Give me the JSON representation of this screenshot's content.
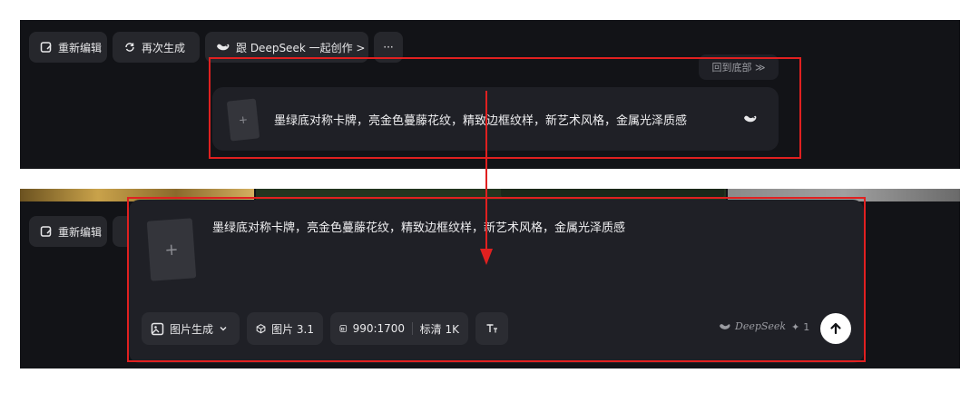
{
  "toolbar": {
    "reedit_label": "重新编辑",
    "regenerate_label": "再次生成",
    "create_with_label": "跟 DeepSeek 一起创作 >",
    "more_label": "···"
  },
  "back_to_bottom_label": "回到底部 ≫",
  "prompt": {
    "text": "墨绿底对称卡牌，亮金色蔓藤花纹，精致边框纹样，新艺术风格，金属光泽质感"
  },
  "bottom_toolbar": {
    "mode_label": "图片生成",
    "model_label": "图片 3.1",
    "ratio_label": "990:1700",
    "quality_label": "标清 1K",
    "deepseek_label": "DeepSeek",
    "credits_label": "1"
  },
  "colors": {
    "accent_red": "#e02020",
    "panel_bg": "#121317"
  }
}
